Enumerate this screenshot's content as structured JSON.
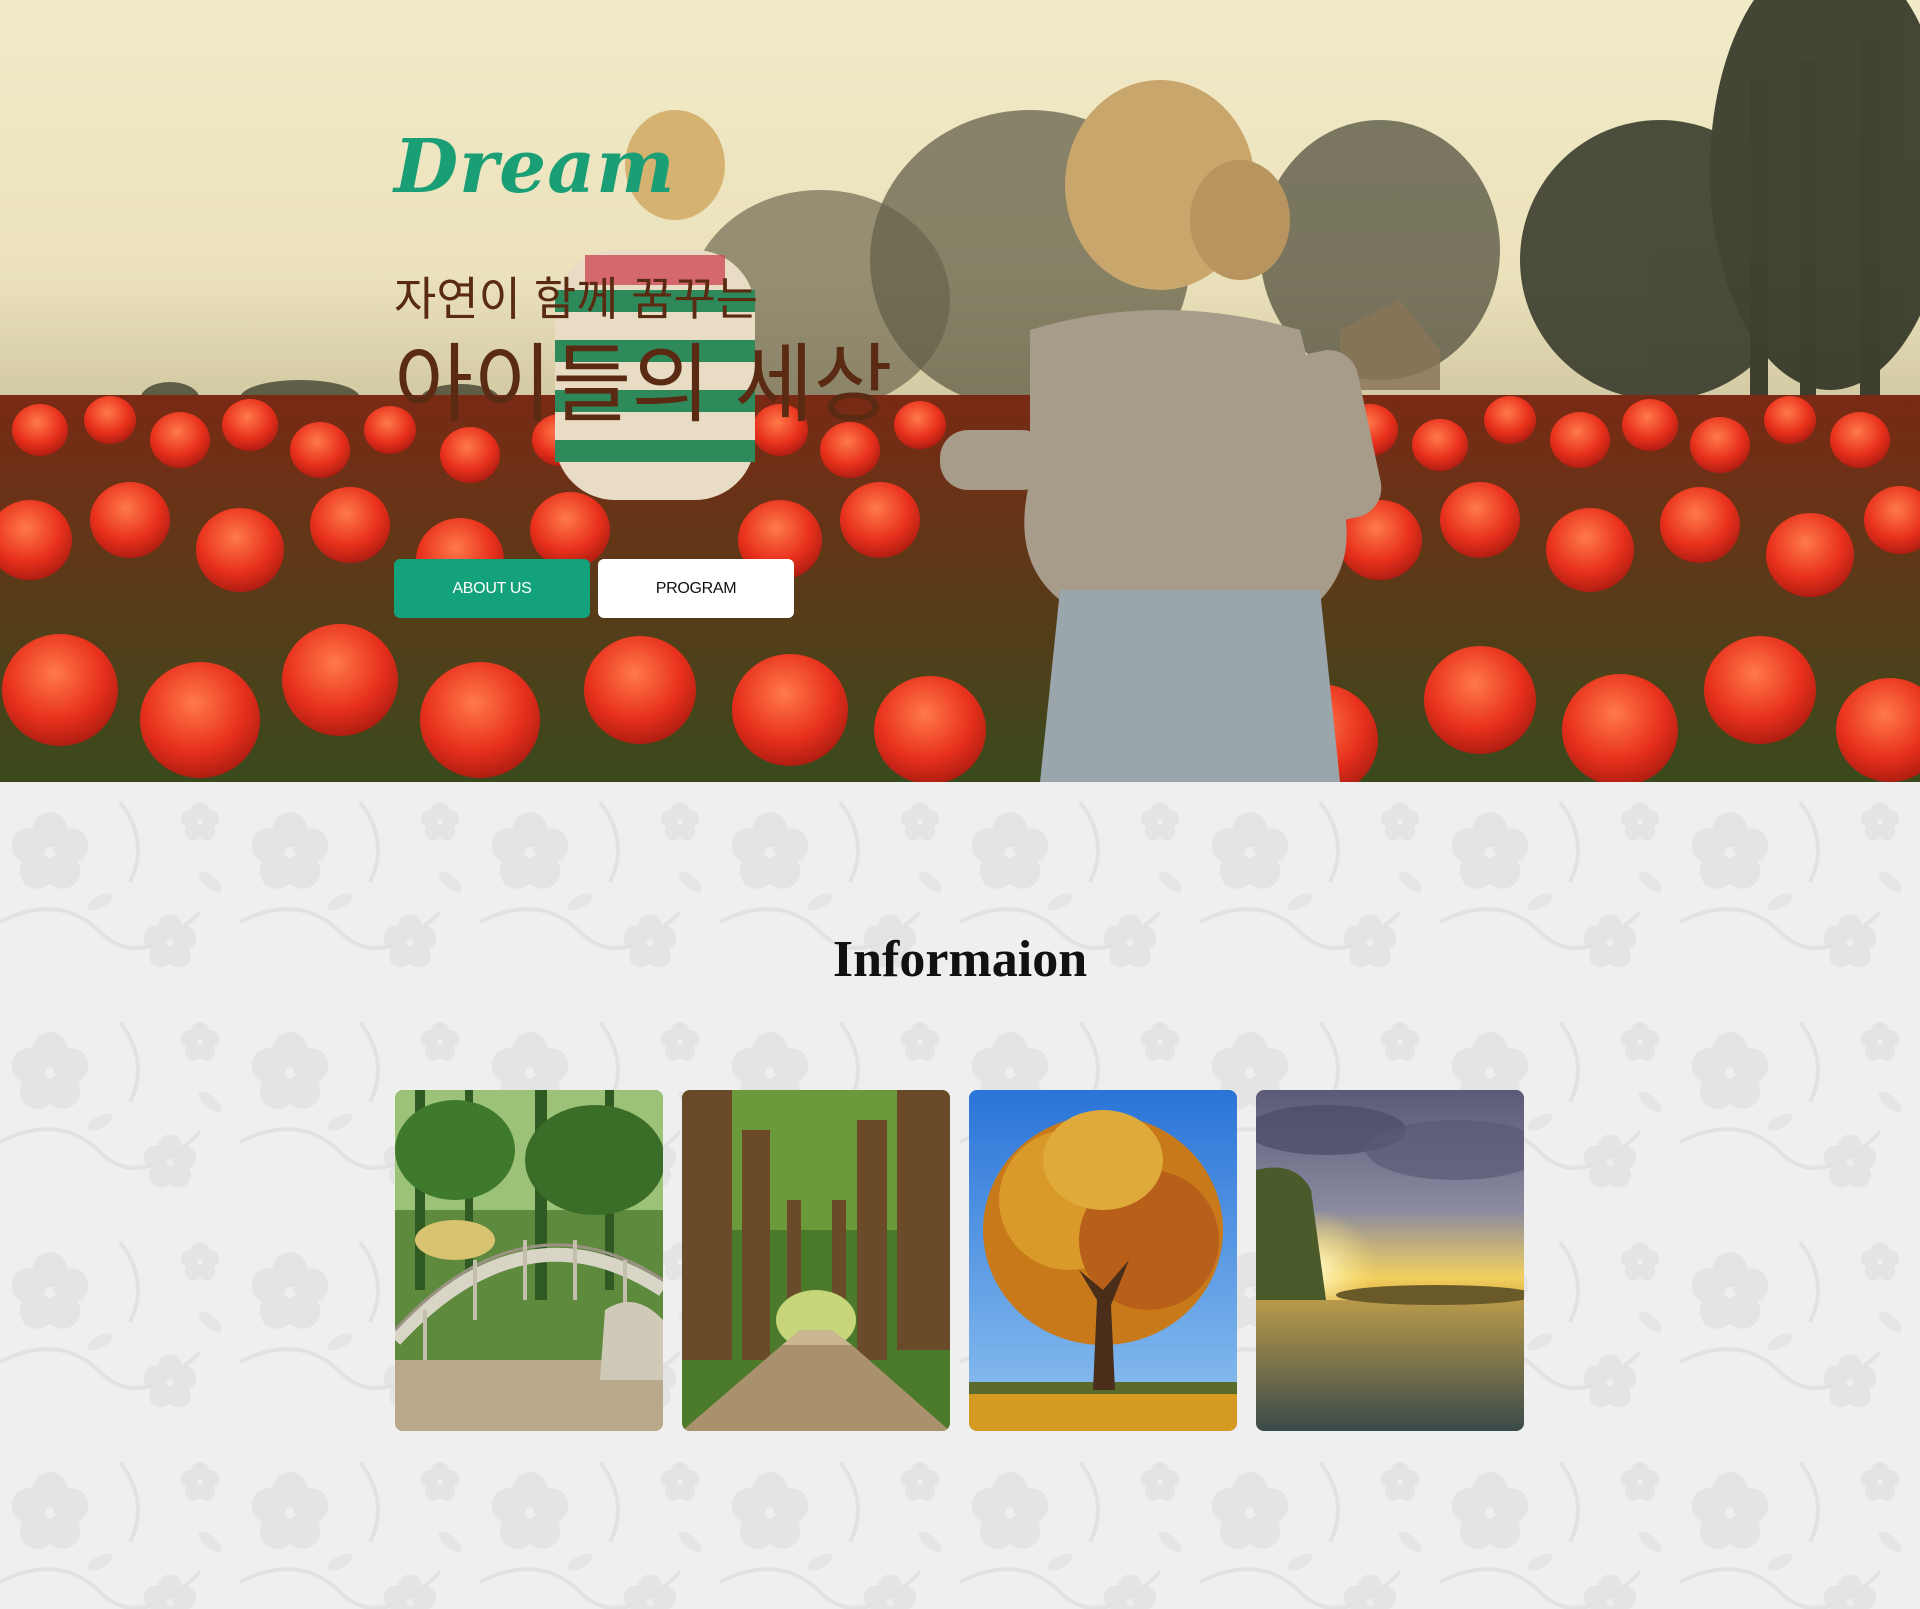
{
  "hero": {
    "logo": "Dream",
    "tagline_small": "자연이 함께 꿈꾸는",
    "tagline_big": "아이들의 세상",
    "buttons": {
      "about": "ABOUT US",
      "program": "PROGRAM"
    }
  },
  "info": {
    "title": "Informaion",
    "cards": [
      {
        "image": "garden-bridge-photo"
      },
      {
        "image": "forest-path-photo"
      },
      {
        "image": "autumn-tree-photo"
      },
      {
        "image": "sunset-river-photo"
      }
    ]
  },
  "colors": {
    "accent": "#14a27a",
    "logo": "#1a9e76",
    "tagline": "#5a2a12",
    "section_bg": "#efefef"
  }
}
